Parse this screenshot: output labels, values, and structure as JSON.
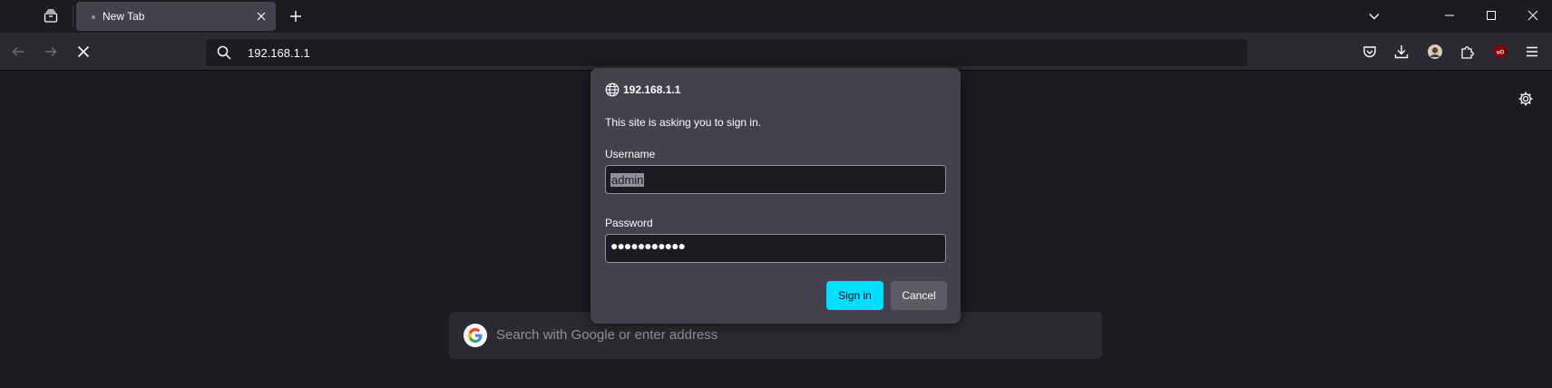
{
  "tabs": [
    {
      "title": "New Tab"
    }
  ],
  "toolbar": {
    "url": "192.168.1.1"
  },
  "dialog": {
    "host": "192.168.1.1",
    "message": "This site is asking you to sign in.",
    "username_label": "Username",
    "username_value": "admin",
    "password_label": "Password",
    "password_mask": "●●●●●●●●●●●",
    "sign_in_label": "Sign in",
    "cancel_label": "Cancel"
  },
  "newtab": {
    "search_placeholder": "Search with Google or enter address"
  },
  "colors": {
    "accent": "#00ddff",
    "background": "#1c1b22",
    "toolbar": "#2b2a33",
    "dialog": "#42414d"
  }
}
